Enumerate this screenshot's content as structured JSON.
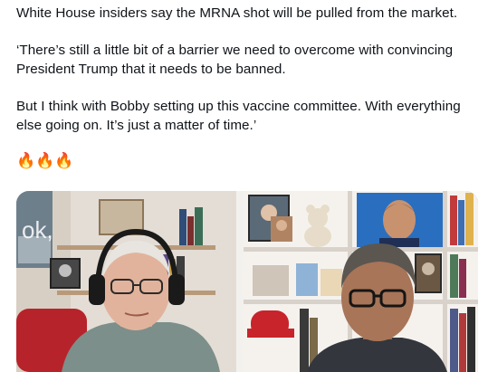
{
  "post": {
    "paragraphs": [
      "White House insiders say the MRNA shot will be pulled from the market.",
      "‘There’s still a little bit of a barrier we need to overcome with convincing President Trump that it needs to be banned.",
      "But I think with Bobby setting up this vaccine committee. With everything else going on. It’s just a matter of time.’"
    ],
    "emoji": "🔥🔥🔥"
  },
  "media": {
    "left_video": {
      "partial_text": "ok,"
    }
  }
}
